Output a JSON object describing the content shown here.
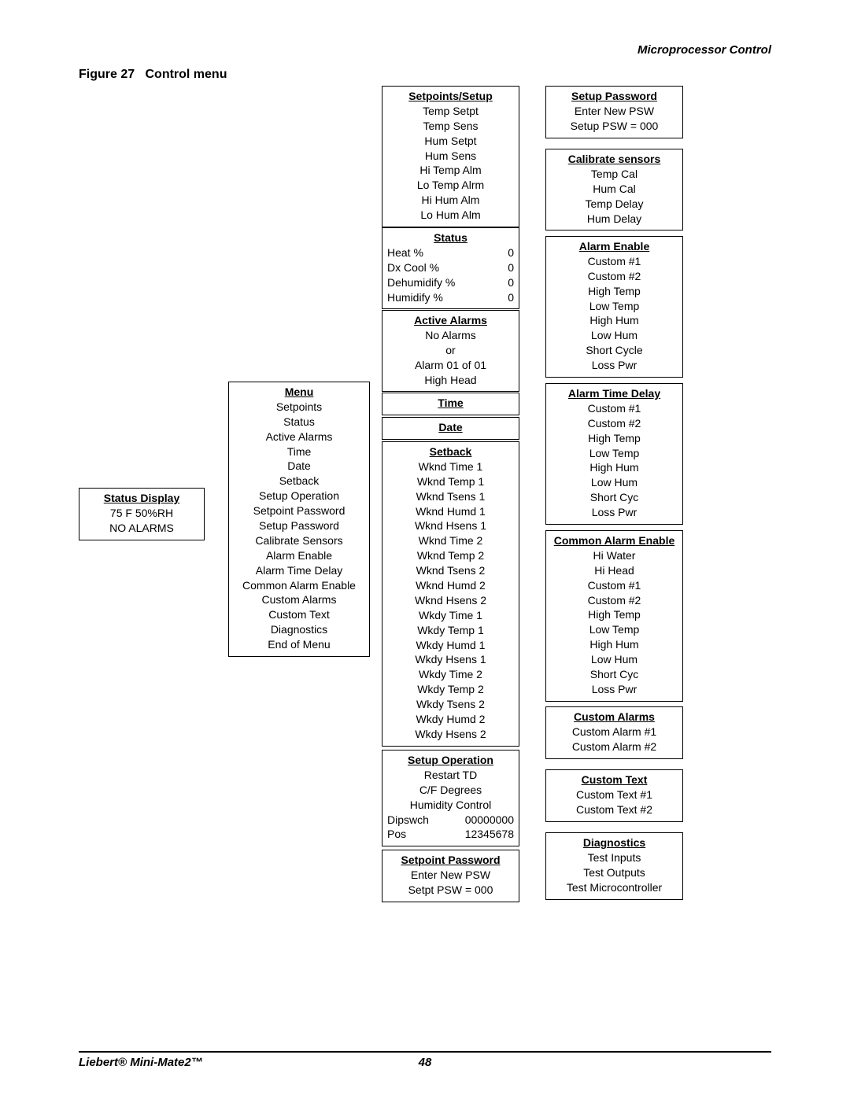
{
  "header": {
    "section": "Microprocessor Control",
    "figure_label": "Figure 27",
    "figure_title": "Control menu"
  },
  "footer": {
    "product": "Liebert® Mini-Mate2™",
    "page": "48"
  },
  "status_display": {
    "title": "Status Display",
    "lines": [
      "75 F 50%RH",
      "NO ALARMS"
    ]
  },
  "menu": {
    "title": "Menu",
    "items": [
      "Setpoints",
      "Status",
      "Active Alarms",
      "Time",
      "Date",
      "Setback",
      "Setup Operation",
      "Setpoint Password",
      "Setup Password",
      "Calibrate Sensors",
      "Alarm Enable",
      "Alarm Time Delay",
      "Common Alarm Enable",
      "Custom Alarms",
      "Custom Text",
      "Diagnostics",
      "End of Menu"
    ]
  },
  "setpoints_setup": {
    "title": "Setpoints/Setup",
    "items": [
      "Temp Setpt",
      "Temp Sens",
      "Hum Setpt",
      "Hum Sens",
      "Hi Temp Alm",
      "Lo Temp Alrm",
      "Hi Hum Alm",
      "Lo Hum Alm"
    ]
  },
  "status": {
    "title": "Status",
    "rows": [
      {
        "label": "Heat %",
        "value": "0"
      },
      {
        "label": "Dx Cool %",
        "value": "0"
      },
      {
        "label": "Dehumidify %",
        "value": "0"
      },
      {
        "label": "Humidify %",
        "value": "0"
      }
    ]
  },
  "active_alarms": {
    "title": "Active Alarms",
    "items": [
      "No Alarms",
      "or",
      "Alarm 01 of 01",
      "High Head"
    ]
  },
  "time": {
    "title": "Time"
  },
  "date": {
    "title": "Date"
  },
  "setback": {
    "title": "Setback",
    "items": [
      "Wknd Time 1",
      "Wknd Temp 1",
      "Wknd Tsens 1",
      "Wknd Humd 1",
      "Wknd Hsens 1",
      "Wknd Time 2",
      "Wknd Temp 2",
      "Wknd Tsens 2",
      "Wknd Humd 2",
      "Wknd Hsens 2",
      "Wkdy Time 1",
      "Wkdy Temp 1",
      "Wkdy Humd 1",
      "Wkdy Hsens 1",
      "Wkdy Time 2",
      "Wkdy Temp 2",
      "Wkdy Tsens 2",
      "Wkdy Humd 2",
      "Wkdy Hsens 2"
    ]
  },
  "setup_operation": {
    "title": "Setup Operation",
    "items_center": [
      "Restart TD",
      "C/F Degrees",
      "Humidity Control"
    ],
    "rows": [
      {
        "label": "Dipswch",
        "value": "00000000"
      },
      {
        "label": "Pos",
        "value": "12345678"
      }
    ]
  },
  "setpoint_password": {
    "title": "Setpoint Password",
    "items": [
      "Enter New PSW",
      "Setpt PSW = 000"
    ]
  },
  "setup_password": {
    "title": "Setup Password",
    "items": [
      "Enter New PSW",
      "Setup PSW = 000"
    ]
  },
  "calibrate_sensors": {
    "title": "Calibrate sensors",
    "items": [
      "Temp Cal",
      "Hum Cal",
      "Temp Delay",
      "Hum Delay"
    ]
  },
  "alarm_enable": {
    "title": "Alarm Enable",
    "items": [
      "Custom #1",
      "Custom #2",
      "High Temp",
      "Low Temp",
      "High Hum",
      "Low Hum",
      "Short Cycle",
      "Loss Pwr"
    ]
  },
  "alarm_time_delay": {
    "title": "Alarm Time Delay",
    "items": [
      "Custom #1",
      "Custom #2",
      "High Temp",
      "Low Temp",
      "High Hum",
      "Low Hum",
      "Short Cyc",
      "Loss Pwr"
    ]
  },
  "common_alarm_enable": {
    "title": "Common Alarm Enable",
    "items": [
      "Hi Water",
      "Hi Head",
      "Custom #1",
      "Custom #2",
      "High Temp",
      "Low Temp",
      "High Hum",
      "Low Hum",
      "Short Cyc",
      "Loss Pwr"
    ]
  },
  "custom_alarms": {
    "title": "Custom Alarms",
    "items": [
      "Custom Alarm #1",
      "Custom Alarm #2"
    ]
  },
  "custom_text": {
    "title": "Custom Text",
    "items": [
      "Custom Text #1",
      "Custom Text #2"
    ]
  },
  "diagnostics": {
    "title": "Diagnostics",
    "items": [
      "Test Inputs",
      "Test Outputs",
      "Test Microcontroller"
    ]
  }
}
